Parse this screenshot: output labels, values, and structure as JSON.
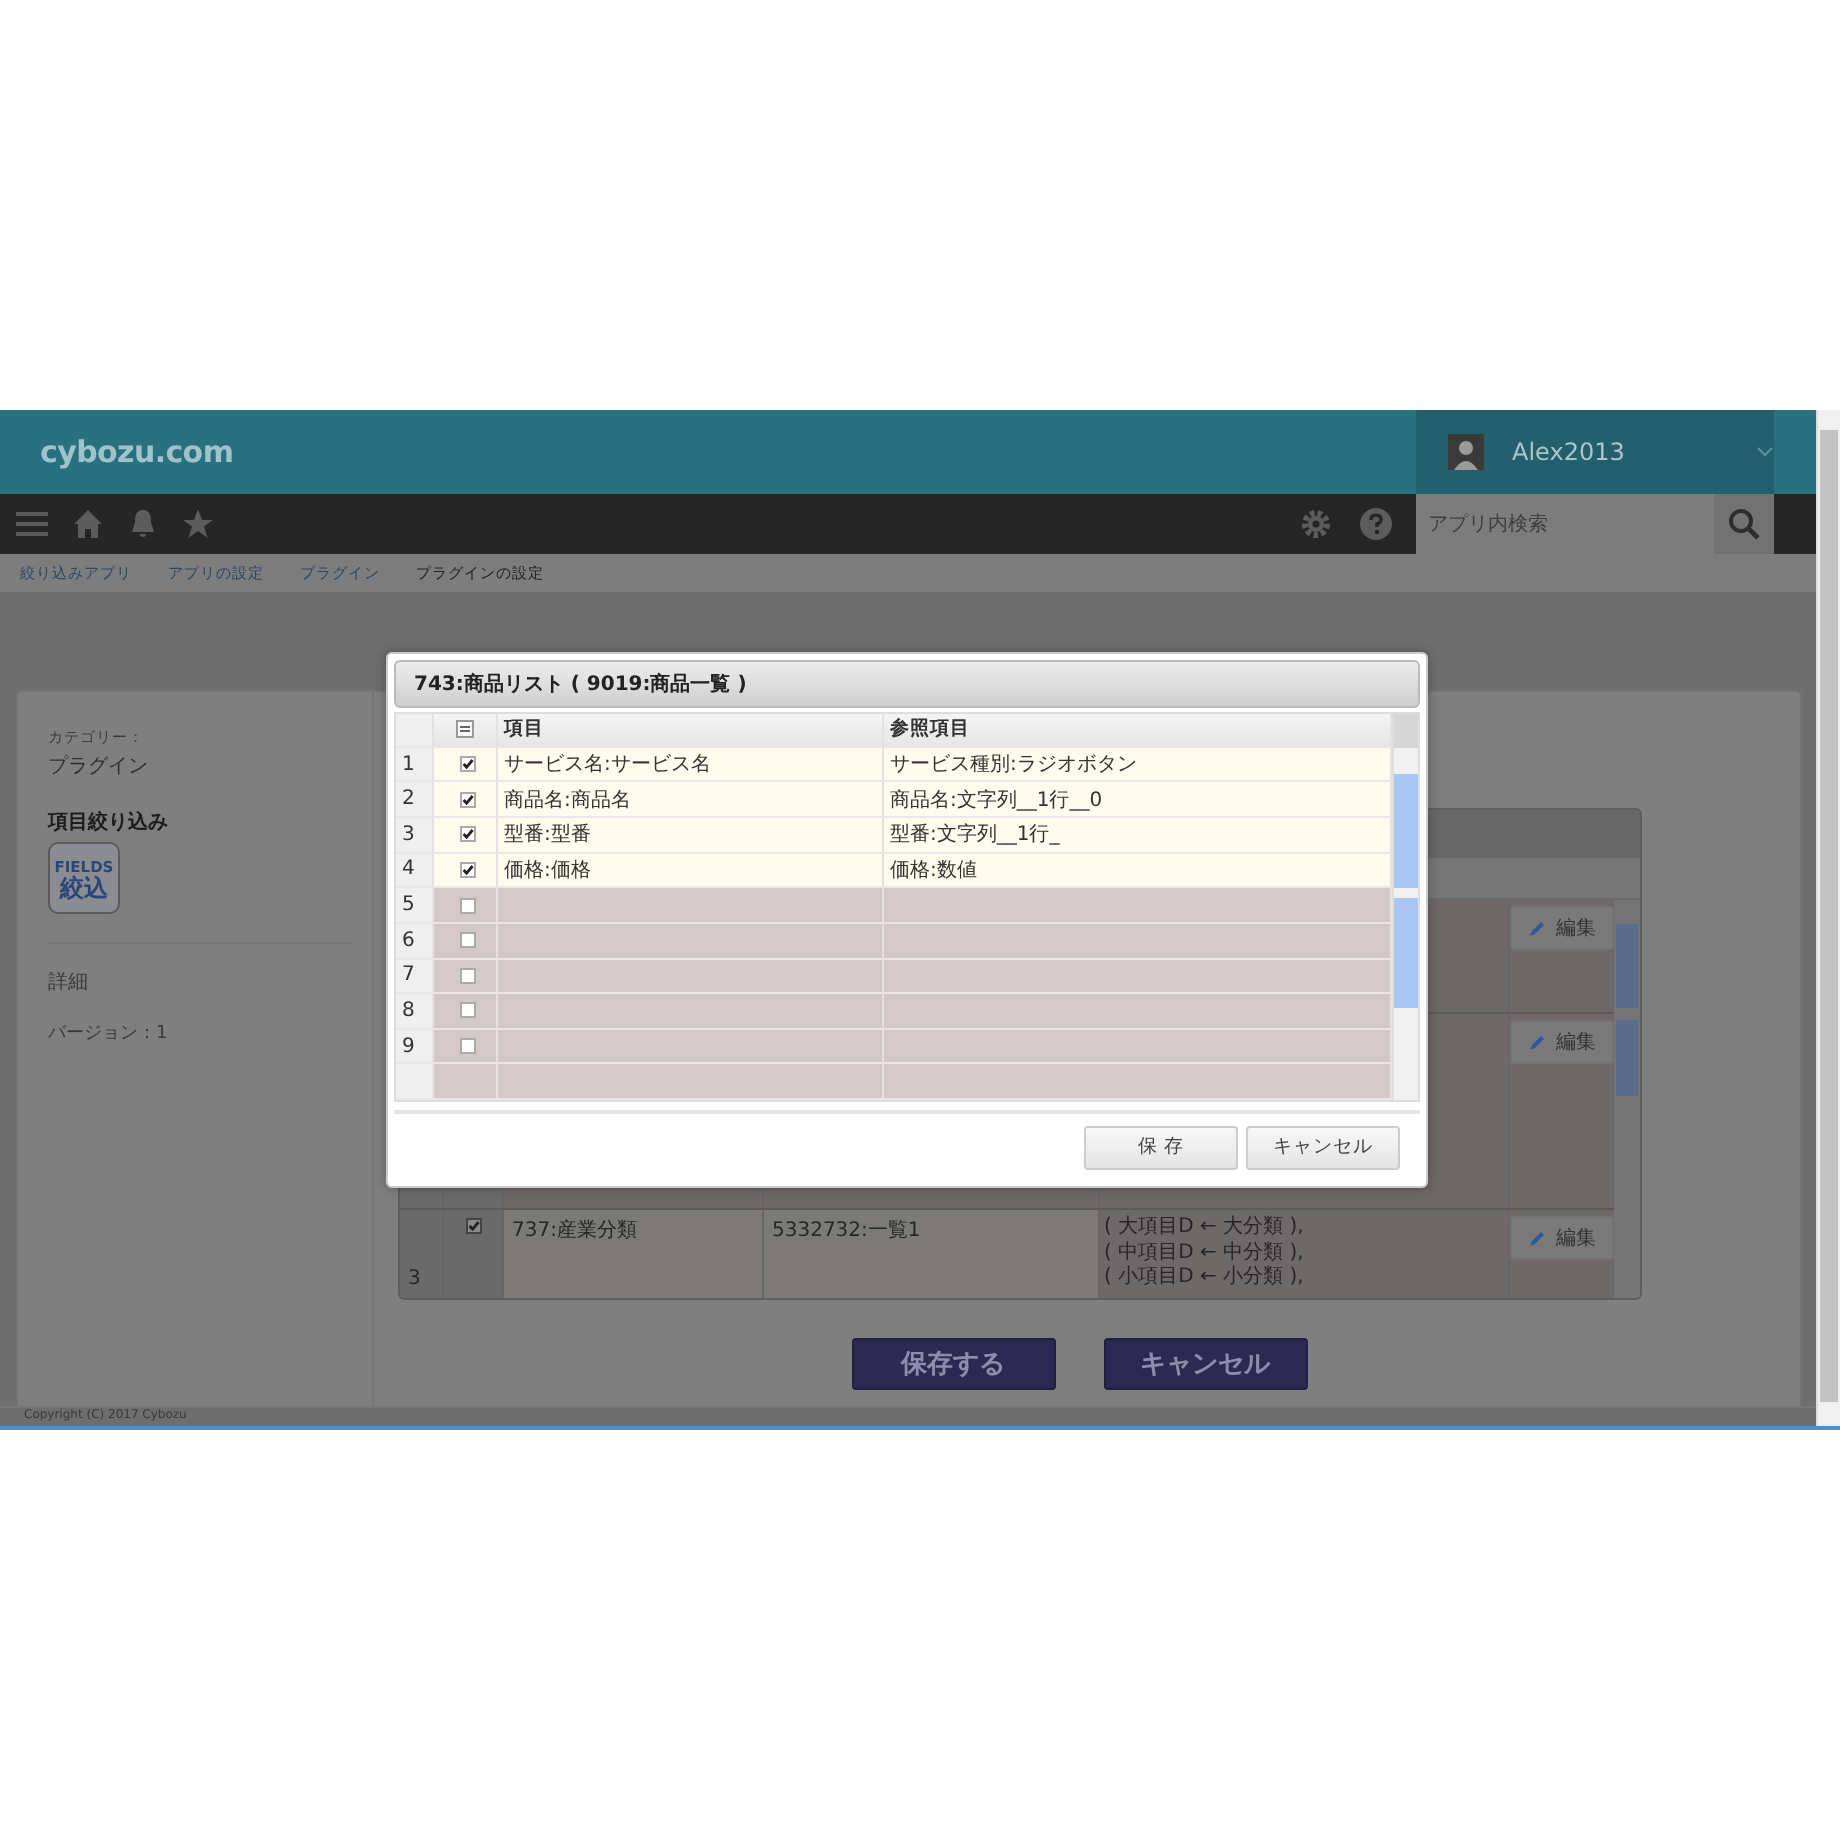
{
  "header": {
    "logo": "cybozu.com",
    "user": "Alex2013"
  },
  "toolbar": {
    "search": {
      "placeholder": "アプリ内検索"
    }
  },
  "breadcrumbs": [
    "絞り込みアプリ",
    "アプリの設定",
    "プラグイン",
    "プラグインの設定"
  ],
  "sidebar": {
    "category_label": "カテゴリー：",
    "category": "プラグイン",
    "plugin_name": "項目絞り込み",
    "plugin_icon": {
      "line_1": "FIELDS",
      "line_2": "絞込"
    },
    "details": "詳細",
    "version": "バージョン：1"
  },
  "settings_table": {
    "rows": [
      {
        "edit": "編集"
      },
      {
        "edit": "編集"
      },
      {
        "number": "3",
        "checked": true,
        "field": "737:産業分類",
        "list": "5332732:一覧1",
        "mappings": [
          "( 大項目D ← 大分類 ),",
          "( 中項目D ← 中分類 ),",
          "( 小項目D ← 小分類 ),"
        ],
        "edit": "編集"
      }
    ]
  },
  "actions": [
    "保存する",
    "キャンセル"
  ],
  "footer": "Copyright (C) 2017 Cybozu",
  "dialog": {
    "title": "743:商品リスト ( 9019:商品一覧 )",
    "columns": [
      "項目",
      "参照項目"
    ],
    "rows": [
      {
        "number": "1",
        "checked": true,
        "field": "サービス名:サービス名",
        "reference": "サービス種別:ラジオボタン"
      },
      {
        "number": "2",
        "checked": true,
        "field": "商品名:商品名",
        "reference": "商品名:文字列__1行__0"
      },
      {
        "number": "3",
        "checked": true,
        "field": "型番:型番",
        "reference": "型番:文字列__1行_"
      },
      {
        "number": "4",
        "checked": true,
        "field": "価格:価格",
        "reference": "価格:数値"
      },
      {
        "number": "5",
        "checked": false
      },
      {
        "number": "6",
        "checked": false
      },
      {
        "number": "7",
        "checked": false
      },
      {
        "number": "8",
        "checked": false
      },
      {
        "number": "9",
        "checked": false
      }
    ],
    "buttons": [
      "保 存",
      "キャンセル"
    ]
  }
}
